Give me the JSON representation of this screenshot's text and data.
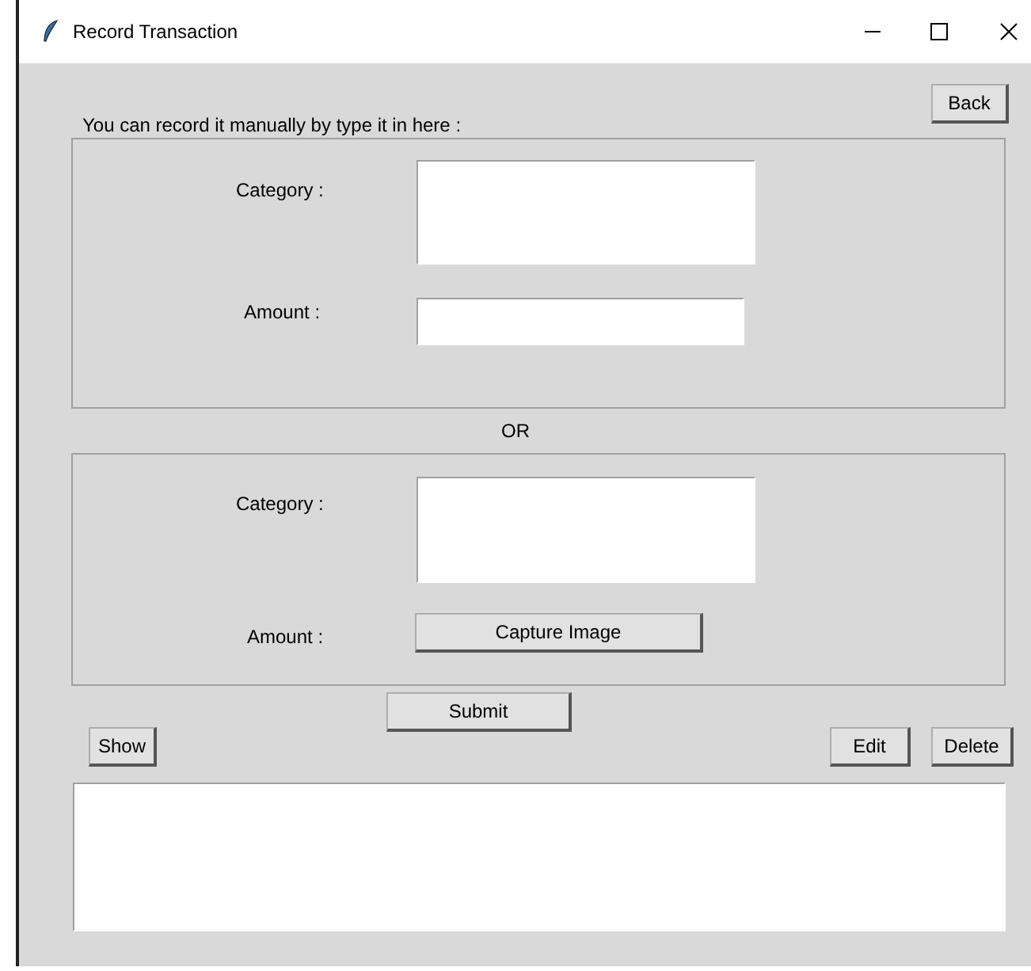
{
  "window": {
    "title": "Record Transaction"
  },
  "back_button": "Back",
  "manual_label": "You can record it manually by type it in here :",
  "manual_section": {
    "category_label": "Category :",
    "amount_label": "Amount :"
  },
  "separator": "OR",
  "image_section": {
    "category_label": "Category :",
    "amount_label": "Amount :",
    "capture_button": "Capture Image"
  },
  "submit_button": "Submit",
  "show_button": "Show",
  "edit_button": "Edit",
  "delete_button": "Delete"
}
